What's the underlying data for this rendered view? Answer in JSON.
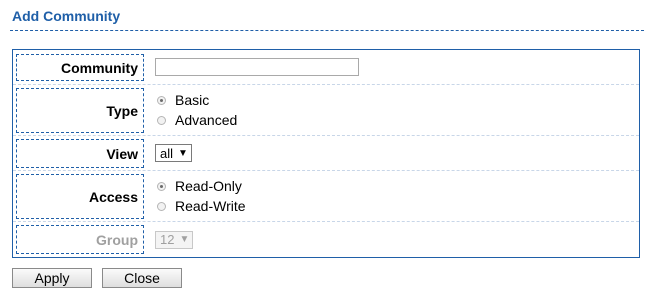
{
  "title": "Add Community",
  "form": {
    "community": {
      "label": "Community",
      "value": ""
    },
    "type": {
      "label": "Type",
      "options": [
        "Basic",
        "Advanced"
      ],
      "selected": "Basic"
    },
    "view": {
      "label": "View",
      "value": "all"
    },
    "access": {
      "label": "Access",
      "options": [
        "Read-Only",
        "Read-Write"
      ],
      "selected": "Read-Only"
    },
    "group": {
      "label": "Group",
      "value": "12",
      "disabled": true
    }
  },
  "buttons": {
    "apply": "Apply",
    "close": "Close"
  }
}
